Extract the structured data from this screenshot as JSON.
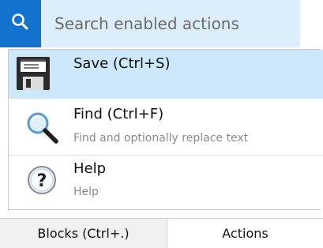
{
  "search": {
    "placeholder": "Search enabled actions",
    "value": ""
  },
  "actions": {
    "items": [
      {
        "title": "Save (Ctrl+S)",
        "description": "",
        "icon": "floppy-disk-icon",
        "selected": true
      },
      {
        "title": "Find (Ctrl+F)",
        "description": "Find and optionally replace text",
        "icon": "magnifier-icon",
        "selected": false
      },
      {
        "title": "Help",
        "description": "Help",
        "icon": "question-mark-icon",
        "selected": false
      }
    ]
  },
  "tabs": [
    {
      "label": "Blocks (Ctrl+.)",
      "active": false
    },
    {
      "label": "Actions",
      "active": true
    }
  ],
  "colors": {
    "accent": "#1273cf",
    "search_bg": "#dceefb",
    "selected_row": "#cde8fa"
  }
}
